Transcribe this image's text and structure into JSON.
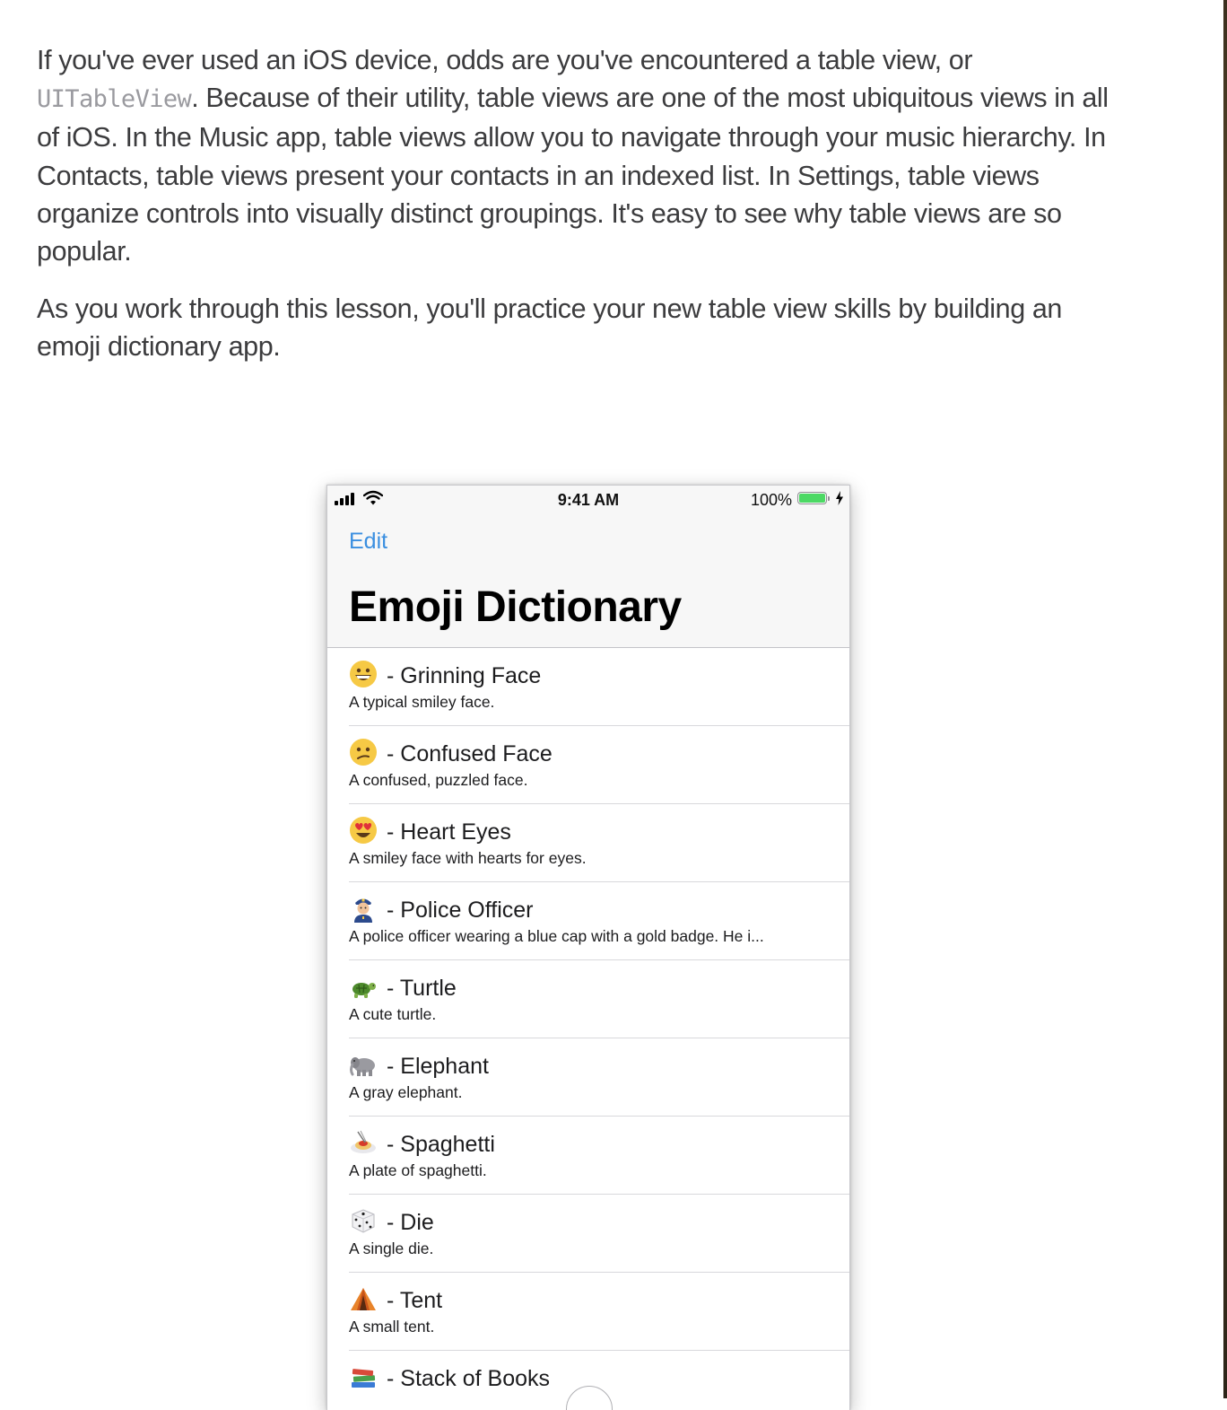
{
  "article": {
    "p1_a": "If you've ever used an iOS device, odds are you've encountered a table view, or ",
    "p1_code": "UITableView",
    "p1_b": ". Because of their utility, table views are one of the most ubiquitous views in all of iOS. In the Music app, table views allow you to navigate through your music hierarchy. In Contacts, table views present your contacts in an indexed list. In Settings, table views organize controls into visually distinct groupings. It's easy to see why table views are so popular.",
    "p2": "As you work through this lesson, you'll practice your new table view skills by building an emoji dictionary app."
  },
  "phone": {
    "status": {
      "time": "9:41 AM",
      "battery_pct": "100%",
      "battery_level": 1.0
    },
    "nav": {
      "edit_label": "Edit",
      "title": "Emoji Dictionary"
    },
    "rows": [
      {
        "icon": "grinning-face-icon",
        "title": "- Grinning Face",
        "subtitle": "A typical smiley face."
      },
      {
        "icon": "confused-face-icon",
        "title": "- Confused Face",
        "subtitle": "A confused, puzzled face."
      },
      {
        "icon": "heart-eyes-icon",
        "title": "- Heart Eyes",
        "subtitle": "A smiley face with hearts for eyes."
      },
      {
        "icon": "police-officer-icon",
        "title": "- Police Officer",
        "subtitle": "A police officer wearing a blue cap with a gold badge. He i..."
      },
      {
        "icon": "turtle-icon",
        "title": "- Turtle",
        "subtitle": "A cute turtle."
      },
      {
        "icon": "elephant-icon",
        "title": "- Elephant",
        "subtitle": "A gray elephant."
      },
      {
        "icon": "spaghetti-icon",
        "title": "- Spaghetti",
        "subtitle": "A plate of spaghetti."
      },
      {
        "icon": "die-icon",
        "title": "- Die",
        "subtitle": "A single die."
      },
      {
        "icon": "tent-icon",
        "title": "- Tent",
        "subtitle": "A small tent."
      },
      {
        "icon": "stack-of-books-icon",
        "title": "- Stack of Books",
        "subtitle": ""
      }
    ]
  },
  "colors": {
    "link_blue": "#3b8fe0",
    "battery_green": "#4cd964"
  }
}
